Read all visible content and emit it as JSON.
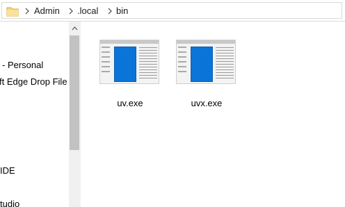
{
  "address_bar": {
    "breadcrumbs": [
      "Admin",
      ".local",
      "bin"
    ]
  },
  "nav_pane": {
    "items": [
      " - Personal",
      "ft Edge Drop File",
      "IDE",
      "tudio"
    ]
  },
  "files": [
    {
      "name": "uv.exe",
      "icon": "exe-file-icon"
    },
    {
      "name": "uvx.exe",
      "icon": "exe-file-icon"
    }
  ],
  "colors": {
    "folder": "#f8d775",
    "accent_blue": "#0a74d9",
    "scroll_thumb": "#c2c2c2"
  }
}
